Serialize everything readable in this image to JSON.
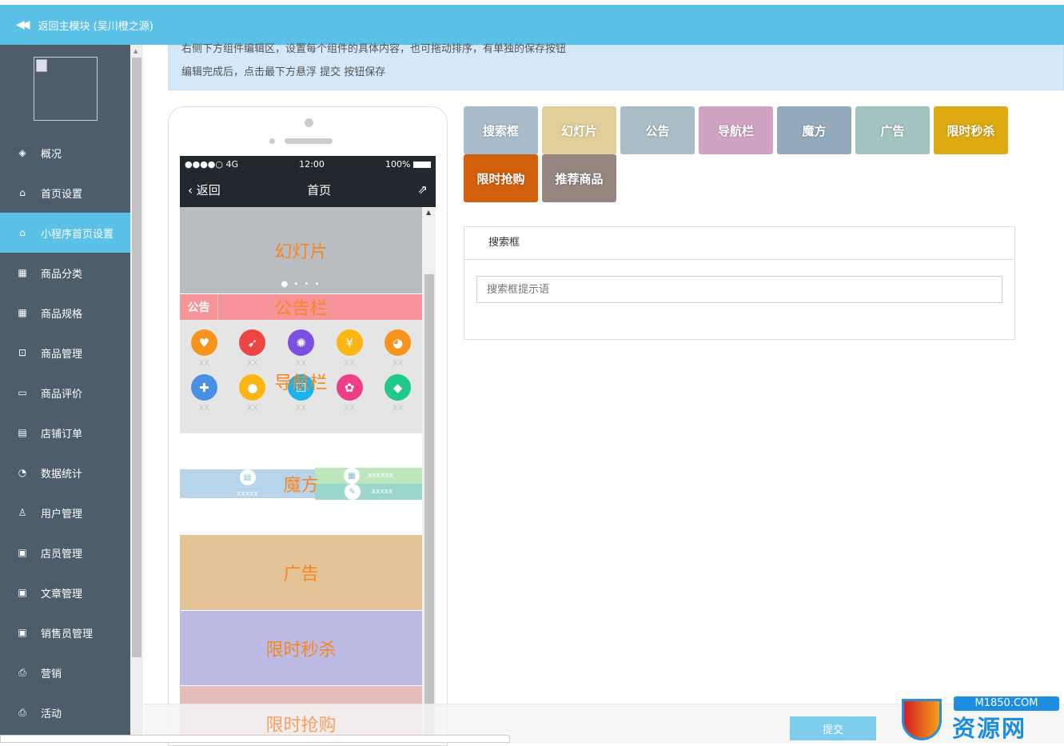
{
  "header": {
    "back_label": "返回主模块 (吴川橙之源)",
    "back_icon": "double-chevron-left-icon"
  },
  "sidebar": {
    "items": [
      {
        "label": "概况",
        "icon": "layers-icon"
      },
      {
        "label": "首页设置",
        "icon": "home-icon"
      },
      {
        "label": "小程序首页设置",
        "icon": "home-icon",
        "active": true
      },
      {
        "label": "商品分类",
        "icon": "grid-icon"
      },
      {
        "label": "商品规格",
        "icon": "grid-icon"
      },
      {
        "label": "商品管理",
        "icon": "inbox-icon"
      },
      {
        "label": "商品评价",
        "icon": "message-icon"
      },
      {
        "label": "店铺订单",
        "icon": "file-icon"
      },
      {
        "label": "数据统计",
        "icon": "pie-chart-icon"
      },
      {
        "label": "用户管理",
        "icon": "user-icon"
      },
      {
        "label": "店员管理",
        "icon": "id-card-icon"
      },
      {
        "label": "文章管理",
        "icon": "id-card-icon"
      },
      {
        "label": "销售员管理",
        "icon": "id-card-icon"
      },
      {
        "label": "营销",
        "icon": "bag-icon"
      },
      {
        "label": "活动",
        "icon": "bag-icon"
      }
    ]
  },
  "info": {
    "line1": "右侧下方组件编辑区，设置每个组件的具体内容，也可拖动排序，有单独的保存按钮",
    "line2": "编辑完成后，点击最下方悬浮 提交 按钮保存"
  },
  "phone": {
    "status": {
      "signal": "●●●●○ 4G",
      "time": "12:00",
      "battery": "100%"
    },
    "nav": {
      "back": "返回",
      "title": "首页"
    },
    "slide_label": "幻灯片",
    "slide_dots": "● • • •",
    "notice_tag": "公告",
    "notice_label": "公告栏",
    "nav_label": "导航栏",
    "nav_items": [
      {
        "label": "XX",
        "color": "#f7941d",
        "glyph": "♥"
      },
      {
        "label": "XX",
        "color": "#ef4444",
        "glyph": "➹"
      },
      {
        "label": "XX",
        "color": "#7b4fe0",
        "glyph": "✺"
      },
      {
        "label": "XX",
        "color": "#fbb614",
        "glyph": "¥"
      },
      {
        "label": "XX",
        "color": "#f7941d",
        "glyph": "◕"
      },
      {
        "label": "XX",
        "color": "#4a90e2",
        "glyph": "✚"
      },
      {
        "label": "XX",
        "color": "#fbb614",
        "glyph": "●"
      },
      {
        "label": "XX",
        "color": "#1ab3ec",
        "glyph": "☑"
      },
      {
        "label": "XX",
        "color": "#ee3f86",
        "glyph": "✿"
      },
      {
        "label": "XX",
        "color": "#1fc98a",
        "glyph": "◆"
      }
    ],
    "cube_label": "魔方",
    "cube_left": "xxxxx",
    "cube_r1": "xxxxxx",
    "cube_r2": "xxxxx",
    "ad_label": "广告",
    "flash_label": "限时秒杀",
    "rush_label": "限时抢购"
  },
  "components": [
    {
      "label": "搜索框",
      "color": "#a9bccb"
    },
    {
      "label": "幻灯片",
      "color": "#e0cf9b"
    },
    {
      "label": "公告",
      "color": "#a9bec6"
    },
    {
      "label": "导航栏",
      "color": "#d1a2c2"
    },
    {
      "label": "魔方",
      "color": "#93a9bc"
    },
    {
      "label": "广告",
      "color": "#a2c3bf"
    },
    {
      "label": "限时秒杀",
      "color": "#ddaa12"
    },
    {
      "label": "限时抢购",
      "color": "#d2600c"
    },
    {
      "label": "推荐商品",
      "color": "#958680"
    }
  ],
  "editor": {
    "title": "搜索框",
    "placeholder": "搜索框提示语"
  },
  "submit_label": "提交",
  "watermark": {
    "domain": "M1850.COM",
    "name": "资源网"
  }
}
